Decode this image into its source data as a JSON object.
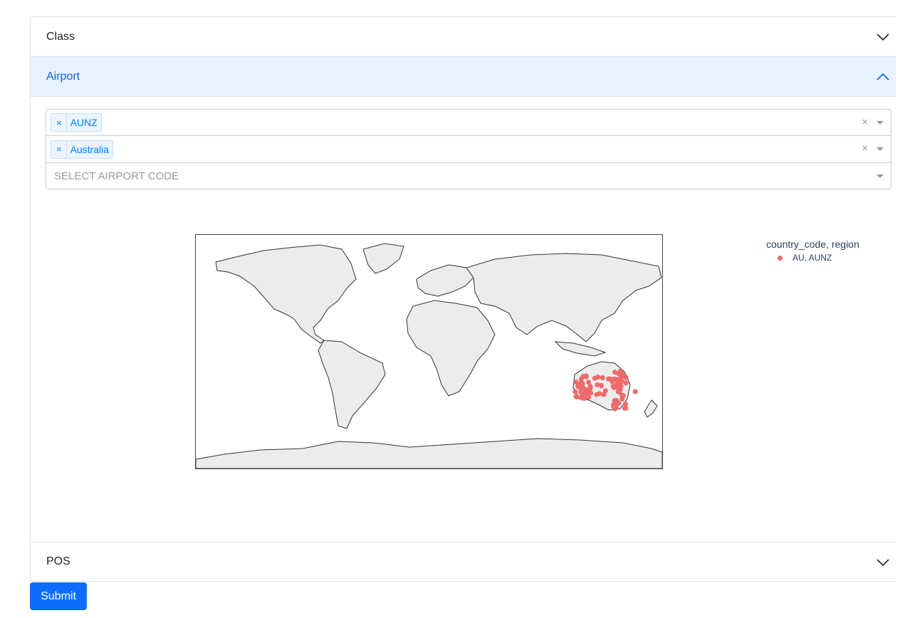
{
  "accordion": {
    "class_label": "Class",
    "airport_label": "Airport",
    "pos_label": "POS"
  },
  "filters": {
    "region_tag": "AUNZ",
    "country_tag": "Australia",
    "airport_placeholder": "SELECT AIRPORT CODE",
    "remove_glyph": "×",
    "clear_glyph": "×"
  },
  "legend": {
    "title": "country_code, region",
    "items": [
      {
        "label": "AU, AUNZ",
        "color": "#ef6a6a"
      }
    ]
  },
  "submit_label": "Submit"
}
